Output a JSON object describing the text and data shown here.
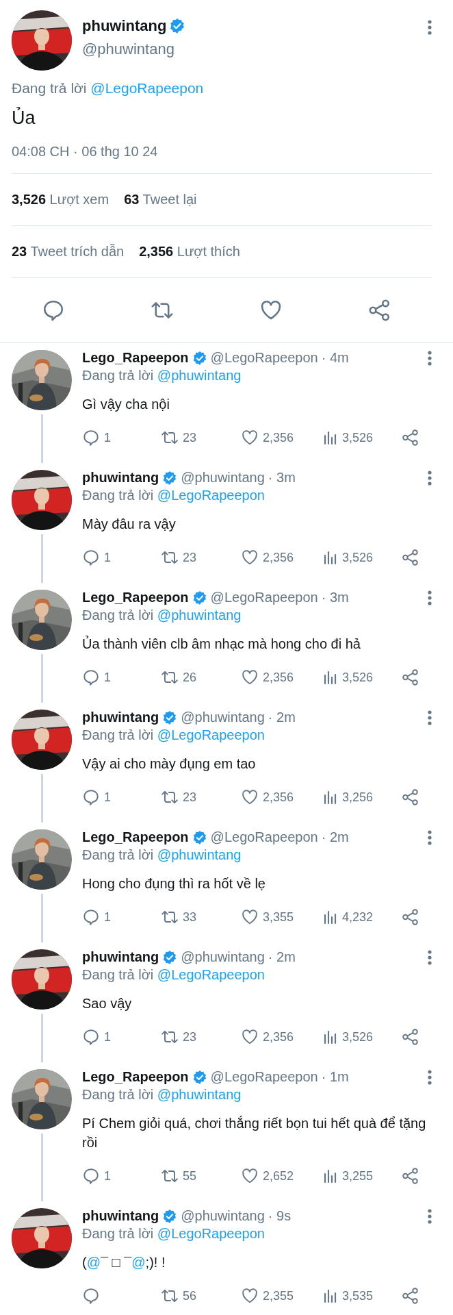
{
  "main_tweet": {
    "author": {
      "name": "phuwintang",
      "handle": "@phuwintang",
      "verified": true
    },
    "replying_to": {
      "prefix": "Đang trả lời",
      "mention": "@LegoRapeepon"
    },
    "text": "Ủa",
    "timestamp": "04:08 CH · 06 thg 10 24",
    "stat_rows": [
      [
        "**3,526** Lượt xem",
        "**63** Tweet lại"
      ],
      [
        "**23** Tweet trích dẫn",
        "**2,356** Lượt thích"
      ]
    ]
  },
  "replies": [
    {
      "name": "Lego_Rapeepon",
      "verified": true,
      "handle": "@LegoRapeepon",
      "time": "· 4m",
      "replying_prefix": "Đang trả lời",
      "replying_to": "@phuwintang",
      "text": "Gì vậy cha nội",
      "replies": "1",
      "retweets": "23",
      "likes": "2,356",
      "views": "3,526",
      "thread_continues": true
    },
    {
      "name": "phuwintang",
      "verified": true,
      "handle": "@phuwintang",
      "time": "· 3m",
      "replying_prefix": "Đang trả lời",
      "replying_to": "@LegoRapeepon",
      "text": "Mày đâu ra vậy",
      "replies": "1",
      "retweets": "23",
      "likes": "2,356",
      "views": "3,526",
      "thread_continues": true
    },
    {
      "name": "Lego_Rapeepon",
      "verified": true,
      "handle": "@LegoRapeepon",
      "time": "· 3m",
      "replying_prefix": "Đang trả lời",
      "replying_to": "@phuwintang",
      "text": "Ủa thành viên clb âm nhạc mà hong cho đi hả",
      "replies": "1",
      "retweets": "26",
      "likes": "2,356",
      "views": "3,526",
      "thread_continues": true
    },
    {
      "name": "phuwintang",
      "verified": true,
      "handle": "@phuwintang",
      "time": "· 2m",
      "replying_prefix": "Đang trả lời",
      "replying_to": "@LegoRapeepon",
      "text": "Vậy ai cho mày đụng em tao",
      "replies": "1",
      "retweets": "23",
      "likes": "2,356",
      "views": "3,256",
      "thread_continues": true
    },
    {
      "name": "Lego_Rapeepon",
      "verified": true,
      "handle": "@LegoRapeepon",
      "time": "· 2m",
      "replying_prefix": "Đang trả lời",
      "replying_to": "@phuwintang",
      "text": "Hong cho đụng thì ra hốt về lẹ",
      "replies": "1",
      "retweets": "33",
      "likes": "3,355",
      "views": "4,232",
      "thread_continues": true
    },
    {
      "name": "phuwintang",
      "verified": true,
      "handle": "@phuwintang",
      "time": "· 2m",
      "replying_prefix": "Đang trả lời",
      "replying_to": "@LegoRapeepon",
      "text": "Sao vậy",
      "replies": "1",
      "retweets": "23",
      "likes": "2,356",
      "views": "3,526",
      "thread_continues": true
    },
    {
      "name": "Lego_Rapeepon",
      "verified": true,
      "handle": "@LegoRapeepon",
      "time": "· 1m",
      "replying_prefix": "Đang trả lời",
      "replying_to": "@phuwintang",
      "text": "Pí Chem giỏi quá, chơi thắng riết bọn tui hết quà để tặng rồi",
      "replies": "1",
      "retweets": "55",
      "likes": "2,652",
      "views": "3,255",
      "thread_continues": true
    },
    {
      "name": "phuwintang",
      "verified": true,
      "handle": "@phuwintang",
      "time": "· 9s",
      "replying_prefix": "Đang trả lời",
      "replying_to": "@LegoRapeepon",
      "text_parts": [
        {
          "text": "(",
          "mention": false
        },
        {
          "text": "@",
          "mention": true
        },
        {
          "text": "¯ □ ¯",
          "mention": false
        },
        {
          "text": "@",
          "mention": true
        },
        {
          "text": ";)!  !",
          "mention": false
        }
      ],
      "retweets": "56",
      "likes": "2,355",
      "views": "3,535",
      "thread_continues": false
    }
  ]
}
